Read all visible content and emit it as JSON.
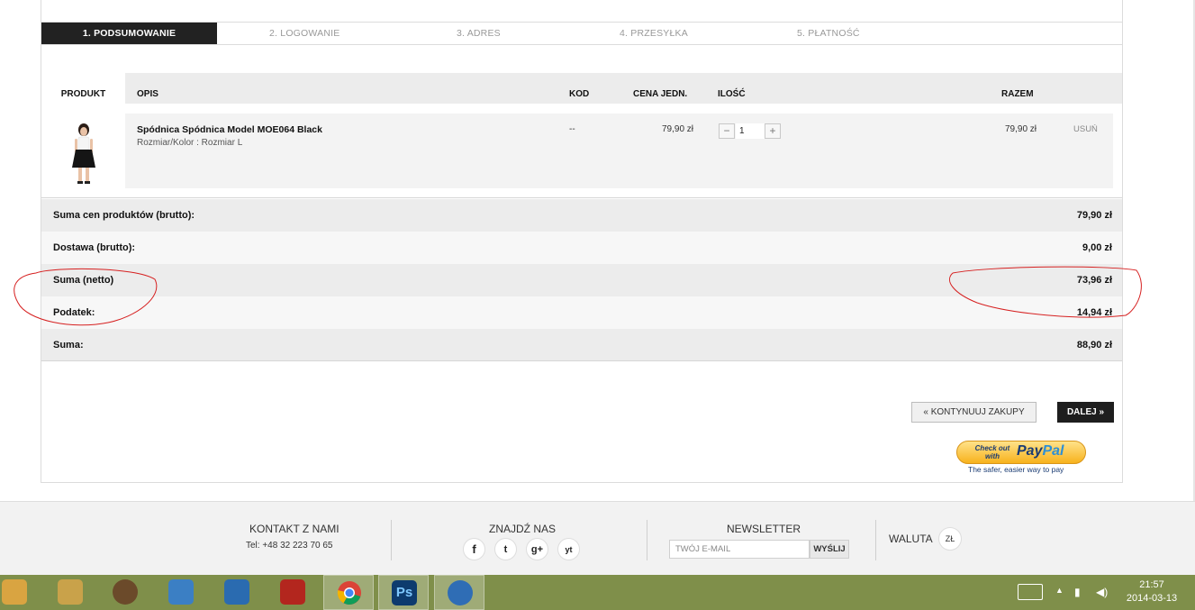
{
  "steps": [
    {
      "label": "1. PODSUMOWANIE"
    },
    {
      "label": "2. LOGOWANIE"
    },
    {
      "label": "3. ADRES"
    },
    {
      "label": "4. PRZESYŁKA"
    },
    {
      "label": "5. PŁATNOŚĆ"
    }
  ],
  "table": {
    "headers": {
      "produkt": "PRODUKT",
      "opis": "OPIS",
      "kod": "KOD",
      "cena": "CENA JEDN.",
      "ilosc": "ILOŚĆ",
      "razem": "RAZEM"
    },
    "item": {
      "name": "Spódnica Spódnica Model MOE064 Black",
      "variant": "Rozmiar/Kolor : Rozmiar L",
      "code": "--",
      "unit_price": "79,90 zł",
      "qty_minus": "−",
      "qty": "1",
      "qty_plus": "+",
      "total": "79,90 zł",
      "remove": "USUŃ"
    }
  },
  "summary": [
    {
      "label": "Suma cen produktów (brutto):",
      "value": "79,90 zł"
    },
    {
      "label": "Dostawa (brutto):",
      "value": "9,00 zł"
    },
    {
      "label": "Suma (netto)",
      "value": "73,96 zł"
    },
    {
      "label": "Podatek:",
      "value": "14,94 zł"
    },
    {
      "label": "Suma:",
      "value": "88,90 zł"
    }
  ],
  "actions": {
    "continue": "« KONTYNUUJ ZAKUPY",
    "next": "DALEJ »"
  },
  "paypal": {
    "checkout": "Check out with",
    "logo_pay": "Pay",
    "logo_pal": "Pal",
    "tagline": "The safer, easier way to pay"
  },
  "footer": {
    "contact_title": "KONTAKT Z NAMI",
    "contact_phone": "Tel: +48 32 223 70 65",
    "social_title": "ZNAJDŹ NAS",
    "social": [
      "f",
      "t",
      "g+",
      "yt"
    ],
    "newsletter_title": "NEWSLETTER",
    "newsletter_placeholder": "TWÓJ E-MAIL",
    "newsletter_button": "WYŚLIJ",
    "currency_title": "WALUTA",
    "currency_value": "ZŁ"
  },
  "taskbar": {
    "time": "21:57",
    "date": "2014-03-13",
    "colors": {
      "explorer": "#d9a441",
      "app1": "#c9a24a",
      "speaker": "#6b4a2a",
      "doc": "#3b7fc4",
      "settings": "#2a6bb0",
      "power": "#b3261e",
      "chrome": "#e8e8e8",
      "photoshop": "#0d3b6e",
      "thunderbird": "#2f6db5"
    }
  }
}
